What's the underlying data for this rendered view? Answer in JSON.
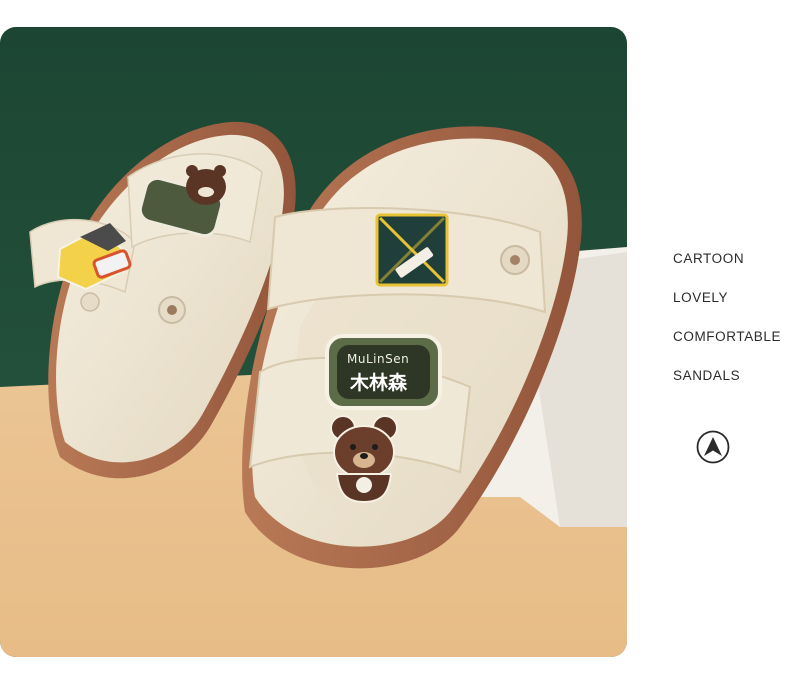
{
  "features": [
    "CARTOON",
    "LOVELY",
    "COMFORTABLE",
    "SANDALS"
  ],
  "badges": {
    "brand_latin": "MuLinSen",
    "brand_cn": "木林森"
  },
  "icons": {
    "nav": "arrow-up-circle-icon"
  },
  "colors": {
    "backdrop_green": "#1f4a37",
    "table_tan": "#e6c08f",
    "sandal_cream": "#efe6d3",
    "sole_brown": "#a8674a",
    "bear_brown": "#5a3526"
  }
}
